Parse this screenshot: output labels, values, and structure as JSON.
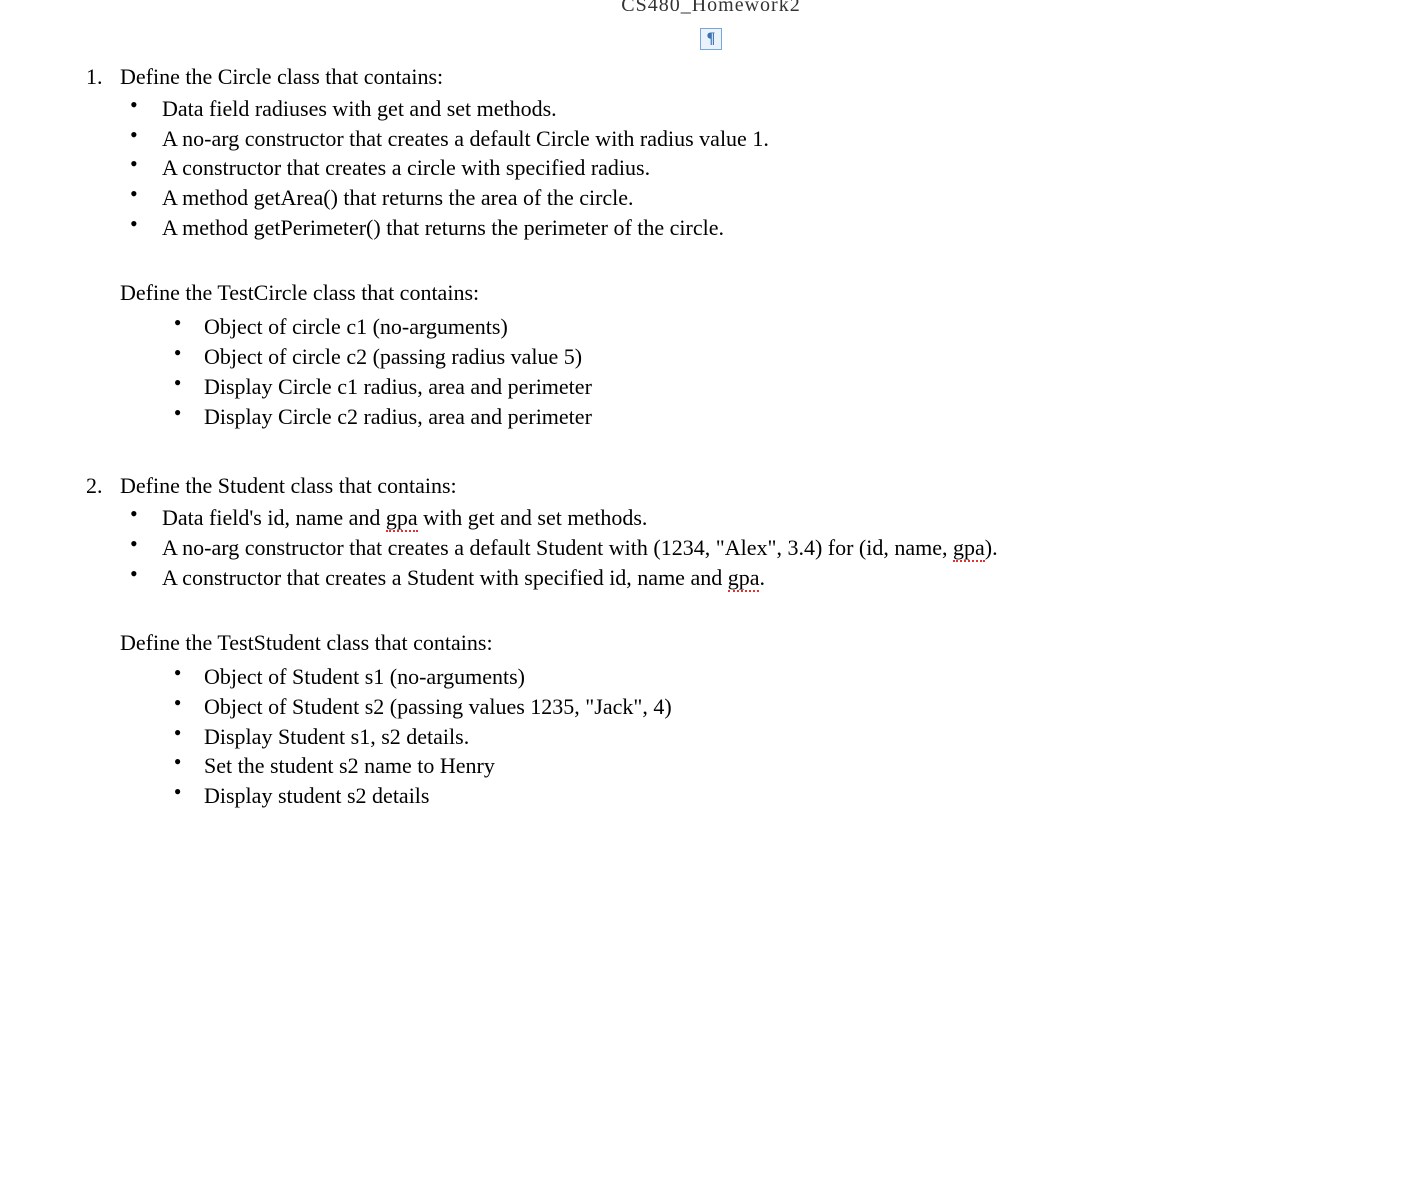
{
  "header_partial": "CS480_Homework2",
  "pilcrow": "¶",
  "q1": {
    "intro": "Define the Circle class that contains:",
    "bullets_a": [
      "Data field radiuses with get and set methods.",
      "A no-arg constructor that creates a default Circle with radius value 1.",
      "A constructor that creates a circle with specified radius.",
      "A method getArea() that returns  the area of the circle.",
      "A method getPerimeter() that returns  the perimeter of the circle."
    ],
    "subhead": "Define the TestCircle class that contains:",
    "bullets_b": [
      "Object of circle c1 (no-arguments)",
      "Object of circle c2 (passing radius value 5)",
      "Display Circle c1 radius, area and perimeter",
      "Display Circle c2 radius, area and perimeter"
    ]
  },
  "q2": {
    "intro": "Define the Student class that contains:",
    "b_a0_pre": "Data field's id, name and ",
    "b_a0_gpa": "gpa",
    "b_a0_post": " with get and set methods.",
    "b_a1_pre": "A no-arg constructor that creates a default Student with (1234, \"Alex\", 3.4) for (id, name, ",
    "b_a1_gpa": "gpa",
    "b_a1_post": ").",
    "b_a2_pre": "A constructor that creates a Student with specified id, name and ",
    "b_a2_gpa": "gpa",
    "b_a2_post": ".",
    "subhead": "Define the TestStudent class that contains:",
    "bullets_b": [
      "Object of Student s1 (no-arguments)",
      "Object of Student s2 (passing values 1235, \"Jack\", 4)",
      "Display Student s1, s2 details.",
      "Set the student s2 name to Henry",
      "Display student s2 details"
    ]
  }
}
